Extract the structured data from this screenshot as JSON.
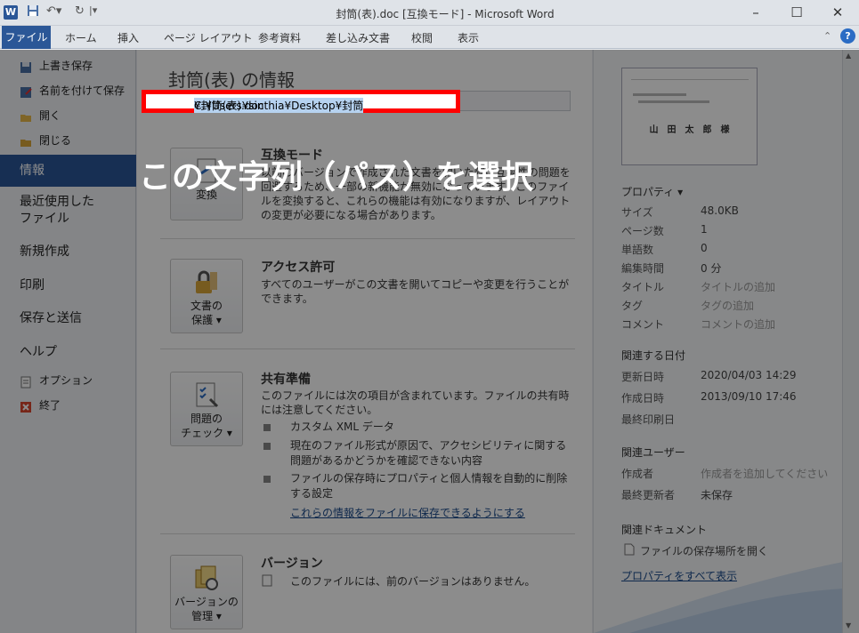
{
  "window": {
    "title": "封筒(表).doc [互換モード] - Microsoft Word",
    "app_icon": "W",
    "controls": [
      "–",
      "☐",
      "✕"
    ]
  },
  "ribbon": {
    "tabs": [
      "ファイル",
      "ホーム",
      "挿入",
      "ページ レイアウト",
      "参考資料",
      "差し込み文書",
      "校閲",
      "表示"
    ]
  },
  "sidebar": {
    "small_items": [
      "上書き保存",
      "名前を付けて保存",
      "開く",
      "閉じる"
    ],
    "big_items": [
      "情報",
      "最近使用した\nファイル",
      "新規作成",
      "印刷",
      "保存と送信",
      "ヘルプ"
    ],
    "bottom_items": [
      "オプション",
      "終了"
    ]
  },
  "main": {
    "title": "封筒(表) の情報",
    "path": {
      "selected": "C:¥Users¥sinthia¥Desktop¥封筒",
      "rest": "¥封筒(表).doc"
    },
    "callout": "この文字列（パス）を選択",
    "compat": {
      "button": "変換",
      "title": "互換モード",
      "text": "以前のバージョンで作成された文書を開いた際に互換性の問題を回避するため、一部の新機能が無効になっています。このファイルを変換すると、これらの機能は有効になりますが、レイアウトの変更が必要になる場合があります。"
    },
    "permissions": {
      "button_line1": "文書の",
      "button_line2": "保護 ▾",
      "title": "アクセス許可",
      "text": "すべてのユーザーがこの文書を開いてコピーや変更を行うことができます。"
    },
    "prepare": {
      "button_line1": "問題の",
      "button_line2": "チェック ▾",
      "title": "共有準備",
      "text": "このファイルには次の項目が含まれています。ファイルの共有時には注意してください。",
      "bullets": [
        "カスタム XML データ",
        "現在のファイル形式が原因で、アクセシビリティに関する問題があるかどうかを確認できない内容",
        "ファイルの保存時にプロパティと個人情報を自動的に削除する設定"
      ],
      "link": "これらの情報をファイルに保存できるようにする"
    },
    "versions": {
      "button_line1": "バージョンの",
      "button_line2": "管理 ▾",
      "title": "バージョン",
      "text": "このファイルには、前のバージョンはありません。"
    }
  },
  "properties": {
    "header": "プロパティ ▾",
    "rows": [
      {
        "label": "サイズ",
        "value": "48.0KB"
      },
      {
        "label": "ページ数",
        "value": "1"
      },
      {
        "label": "単語数",
        "value": "0"
      },
      {
        "label": "編集時間",
        "value": "0 分"
      },
      {
        "label": "タイトル",
        "value": "タイトルの追加"
      },
      {
        "label": "タグ",
        "value": "タグの追加"
      },
      {
        "label": "コメント",
        "value": "コメントの追加"
      }
    ],
    "dates_header": "関連する日付",
    "dates": [
      {
        "label": "更新日時",
        "value": "2020/04/03 14:29"
      },
      {
        "label": "作成日時",
        "value": "2013/09/10 17:46"
      },
      {
        "label": "最終印刷日",
        "value": ""
      }
    ],
    "people_header": "関連ユーザー",
    "people": [
      {
        "label": "作成者",
        "value": "作成者を追加してください"
      },
      {
        "label": "最終更新者",
        "value": "未保存"
      }
    ],
    "docs_header": "関連ドキュメント",
    "open_location": "ファイルの保存場所を開く",
    "show_all": "プロパティをすべて表示"
  },
  "thumbnail": {
    "name": "山　田　太　郎　様"
  }
}
